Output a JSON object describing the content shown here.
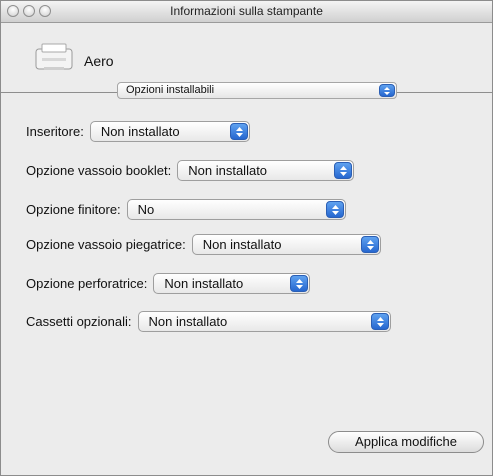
{
  "window": {
    "title": "Informazioni sulla stampante"
  },
  "printer": {
    "name": "Aero",
    "icon": "printer-icon"
  },
  "section_menu": {
    "selected": "Opzioni installabili"
  },
  "options": [
    {
      "label": "Inseritore:",
      "value": "Non installato"
    },
    {
      "label": "Opzione vassoio booklet:",
      "value": "Non installato"
    },
    {
      "label": "Opzione finitore:",
      "value": "No"
    },
    {
      "label": "Opzione vassoio piegatrice:",
      "value": "Non installato"
    },
    {
      "label": "Opzione perforatrice:",
      "value": "Non installato"
    },
    {
      "label": "Cassetti opzionali:",
      "value": "Non installato"
    }
  ],
  "actions": {
    "apply_label": "Applica modifiche"
  },
  "colors": {
    "accent": "#3a7ee0",
    "window_bg": "#ececec"
  }
}
